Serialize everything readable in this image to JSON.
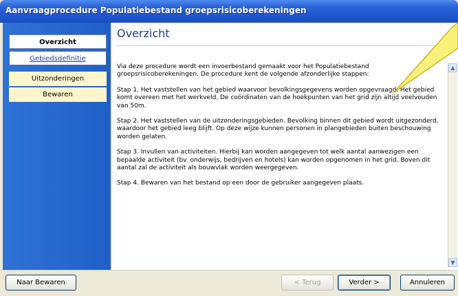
{
  "window": {
    "title": "Aanvraagprocedure Populatiebestand groepsrisicoberekeningen"
  },
  "sidebar": {
    "items": [
      {
        "label": "Overzicht"
      },
      {
        "label": "Gebiedsdefinitie"
      },
      {
        "label": "Uitzonderingen"
      },
      {
        "label": "Bewaren"
      }
    ]
  },
  "main": {
    "heading": "Overzicht",
    "paragraphs": [
      "Via deze procedure wordt een invoerbestand gemaakt voor het Populatiebestand groepsrisicoberekeningen. De procedure kent de volgende afzonderlijke stappen:",
      "Stap 1. Het vaststellen van het gebied waarvoor bevolkingsgegevens worden opgevraagd. Het gebied komt overeen met het werkveld. De coördinaten van de hoekpunten van het grid zijn altijd veelvouden van 50m.",
      "Stap 2. Het vaststellen van de uitzonderingsgebieden. Bevolking binnen dit gebied wordt uitgezonderd, waardoor het gebied leeg blijft. Op deze wijze kunnen personen in plangebieden buiten beschouwing worden gelaten.",
      "Stap 3. Invullen van activiteiten. Hierbij kan worden aangegeven tot welk aantal aanwezigen een bepaalde activiteit (bv. onderwijs, bedrijven en hotels) kan worden opgenomen in het grid. Boven dit aantal zal de activiteit als bouwvlak worden weergegeven.",
      "Stap 4. Bewaren van het bestand op een door de gebruiker aangegeven plaats."
    ]
  },
  "buttons": {
    "naar_bewaren": "Naar Bewaren",
    "terug": "< Terug",
    "verder": "Verder >",
    "annuleren": "Annuleren"
  },
  "colors": {
    "callout": "#f8f27a",
    "sidebar": "#2a69d2",
    "titlebar": "#2a63d8"
  }
}
